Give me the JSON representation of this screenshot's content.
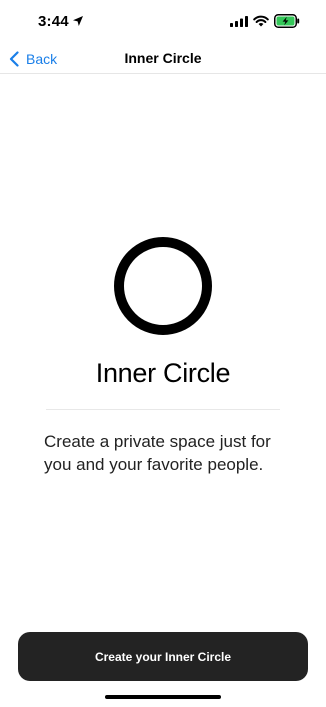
{
  "status_bar": {
    "time": "3:44",
    "icons": [
      "location-arrow-icon",
      "cellular-signal-icon",
      "wifi-icon",
      "battery-charging-icon"
    ],
    "battery_color": "#34c759"
  },
  "nav": {
    "back_label": "Back",
    "title": "Inner Circle",
    "accent_color": "#1a7fe8"
  },
  "hero": {
    "icon": "circle-logo-icon",
    "title": "Inner Circle",
    "description": "Create a private space just for you and your favorite people."
  },
  "cta": {
    "label": "Create your Inner Circle",
    "background_color": "#232323"
  }
}
